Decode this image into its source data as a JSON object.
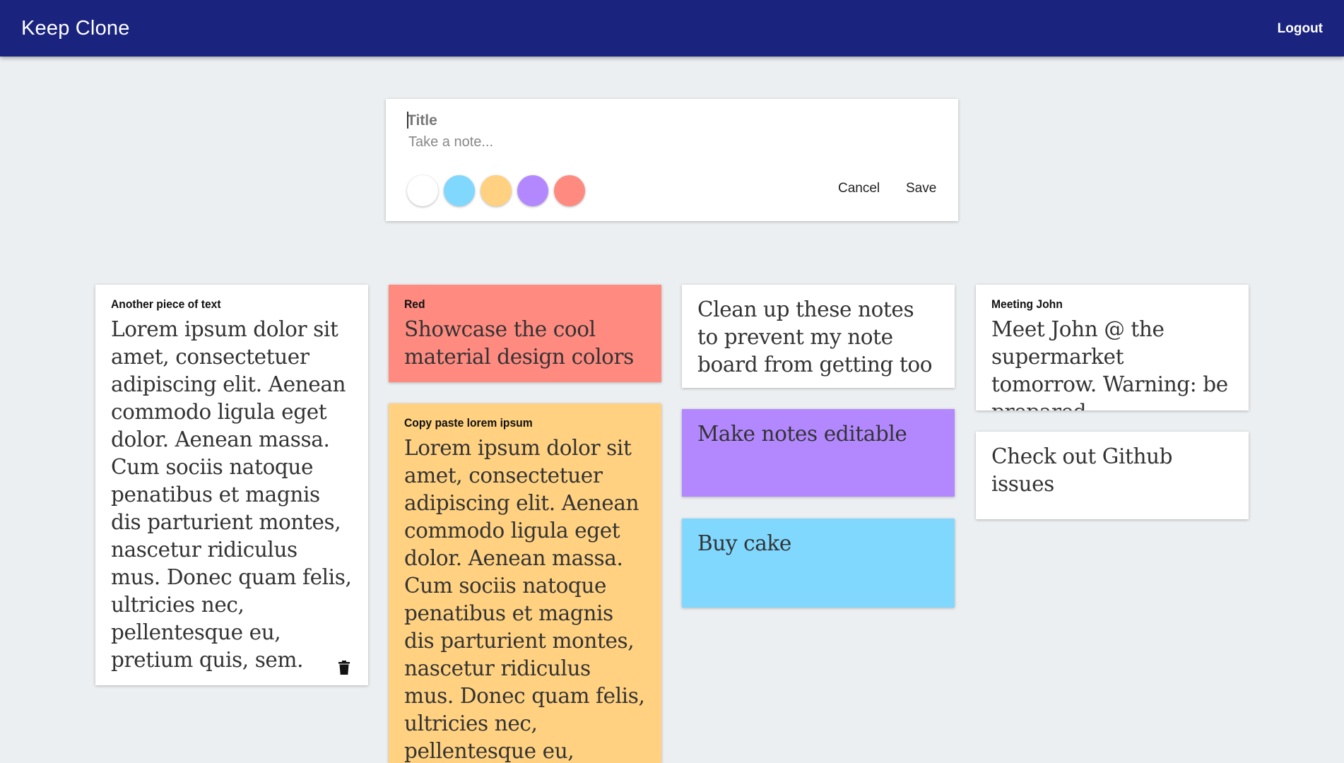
{
  "appbar": {
    "title": "Keep Clone",
    "logout_label": "Logout",
    "color": "#1a237e"
  },
  "composer": {
    "title_placeholder": "Title",
    "note_placeholder": "Take a note...",
    "swatches": [
      {
        "name": "white",
        "color": "#ffffff"
      },
      {
        "name": "blue",
        "color": "#80d8ff"
      },
      {
        "name": "yellow",
        "color": "#ffd180"
      },
      {
        "name": "purple",
        "color": "#b388ff"
      },
      {
        "name": "red",
        "color": "#ff8a80"
      }
    ],
    "cancel_label": "Cancel",
    "save_label": "Save"
  },
  "notes": [
    {
      "title": "Another piece of text",
      "body": "Lorem ipsum dolor sit amet, consectetuer adipiscing elit. Aenean commodo ligula eget dolor. Aenean massa. Cum sociis natoque penatibus et magnis dis parturient montes, nascetur ridiculus mus. Donec quam felis, ultricies nec, pellentesque eu, pretium quis, sem.",
      "color": "#ffffff",
      "icon": "trash-icon"
    },
    {
      "title": "Red",
      "body": "Showcase the cool material design colors",
      "color": "#ff8a80"
    },
    {
      "title": "Copy paste lorem ipsum",
      "body": "Lorem ipsum dolor sit amet, consectetuer adipiscing elit. Aenean commodo ligula eget dolor. Aenean massa. Cum sociis natoque penatibus et magnis dis parturient montes, nascetur ridiculus mus. Donec quam felis, ultricies nec, pellentesque eu,",
      "color": "#ffd180"
    },
    {
      "title": "",
      "body": "Clean up these notes to prevent my note board from getting too messy",
      "color": "#ffffff"
    },
    {
      "title": "",
      "body": "Make notes editable",
      "color": "#b388ff"
    },
    {
      "title": "",
      "body": "Buy cake",
      "color": "#80d8ff"
    },
    {
      "title": "Meeting John",
      "body": "Meet John @ the supermarket tomorrow. Warning: be prepared.",
      "color": "#ffffff"
    },
    {
      "title": "",
      "body": "Check out Github issues",
      "color": "#ffffff"
    }
  ]
}
